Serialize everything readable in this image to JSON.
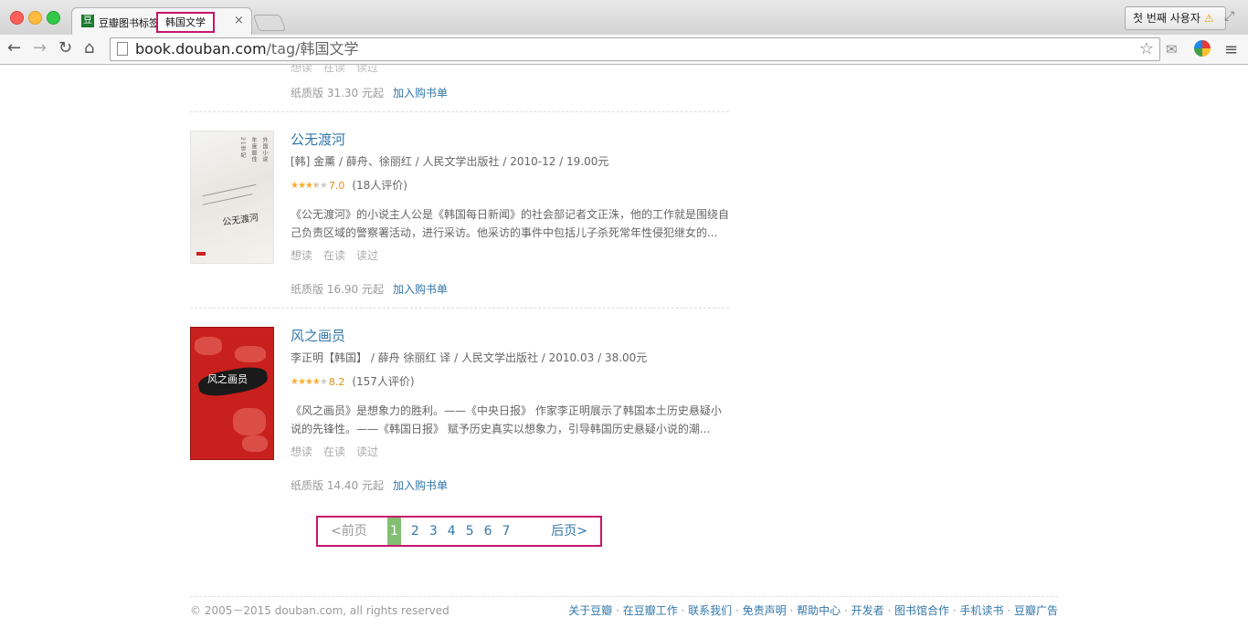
{
  "browser": {
    "tab_title": "豆瓣图书标签",
    "tab_title_highlight": "韩国文学",
    "tab_favicon": "豆",
    "tab_close": "×",
    "profile_label": "첫 번째 사용자",
    "profile_warning": "⚠",
    "url_host": "book.douban.com",
    "url_path": "/tag/韩国文学"
  },
  "previous_item": {
    "actions": [
      "想读",
      "在读",
      "读过"
    ],
    "price": "纸质版 31.30 元起",
    "add_to_list": "加入购书单"
  },
  "books": [
    {
      "title": "公无渡河",
      "pub": "[韩] 金薰 / 薛舟、徐丽红 / 人民文学出版社 / 2010-12 / 19.00元",
      "stars": 3.5,
      "score": "7.0",
      "rating_count": "(18人评价)",
      "desc_line1": "《公无渡河》的小说主人公是《韩国每日新闻》的社会部记者文正洙，他的工作就是围绕自",
      "desc_line2": "己负责区域的警察署活动，进行采访。他采访的事件中包括儿子杀死常年性侵犯继女的...",
      "actions": [
        "想读",
        "在读",
        "读过"
      ],
      "price": "纸质版 16.90 元起",
      "add_to_list": "加入购书单",
      "cover_title": "公无渡河",
      "cover_vertical": [
        "21世纪",
        "年度最佳",
        "外国小说"
      ]
    },
    {
      "title": "风之画员",
      "pub": "李正明【韩国】 / 薛舟 徐丽红 译 / 人民文学出版社 / 2010.03 / 38.00元",
      "stars": 4,
      "score": "8.2",
      "rating_count": "(157人评价)",
      "desc_line1": "《风之画员》是想象力的胜利。——《中央日报》 作家李正明展示了韩国本土历史悬疑小",
      "desc_line2": "说的先锋性。——《韩国日报》 赋予历史真实以想象力，引导韩国历史悬疑小说的潮...",
      "actions": [
        "想读",
        "在读",
        "读过"
      ],
      "price": "纸质版 14.40 元起",
      "add_to_list": "加入购书单",
      "cover_title": "风之画员"
    }
  ],
  "paginator": {
    "prev": "<前页",
    "pages": [
      "1",
      "2",
      "3",
      "4",
      "5",
      "6",
      "7"
    ],
    "current": "1",
    "next": "后页>"
  },
  "footer": {
    "copyright": "© 2005－2015 douban.com, all rights reserved",
    "links": [
      "关于豆瓣",
      "在豆瓣工作",
      "联系我们",
      "免责声明",
      "帮助中心",
      "开发者",
      "图书馆合作",
      "手机读书",
      "豆瓣广告"
    ]
  },
  "colors": {
    "link": "#3377aa",
    "highlight_box": "#c8146c",
    "current_page": "#83bf73",
    "star": "#ffac2d"
  }
}
